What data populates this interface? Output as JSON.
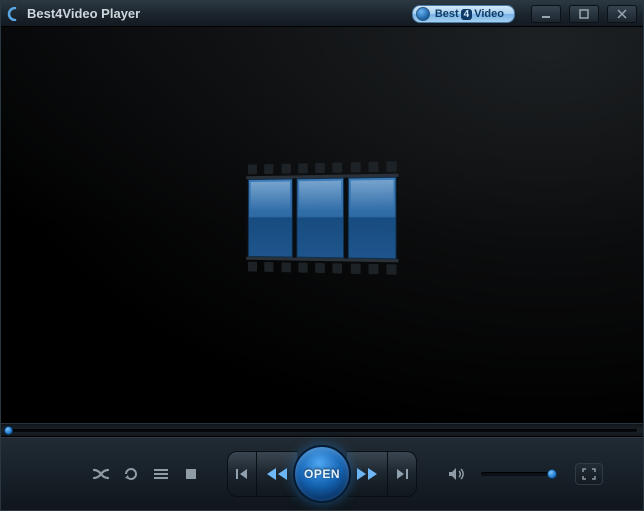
{
  "titlebar": {
    "app_title": "Best4Video Player",
    "brand_left": "Best",
    "brand_num": "4",
    "brand_right": "Video"
  },
  "controls": {
    "open_label": "OPEN"
  },
  "icons": {
    "logo": "c-logo-icon",
    "minimize": "minimize-icon",
    "maximize": "maximize-icon",
    "close": "close-icon",
    "shuffle": "shuffle-icon",
    "repeat": "repeat-icon",
    "playlist": "playlist-icon",
    "stop": "stop-icon",
    "prev": "skip-prev-icon",
    "rewind": "rewind-icon",
    "forward": "forward-icon",
    "next": "skip-next-icon",
    "volume": "volume-icon",
    "fullscreen": "fullscreen-icon"
  },
  "colors": {
    "accent": "#1d72c4",
    "frame": "#2a3138",
    "titlebar_bg": "#1c262e"
  }
}
